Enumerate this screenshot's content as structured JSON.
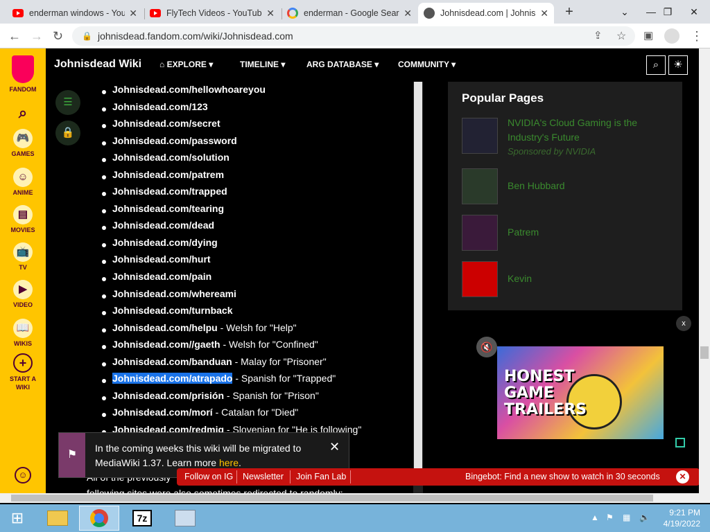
{
  "tabs": [
    {
      "title": "enderman windows - You",
      "icon": "youtube-icon"
    },
    {
      "title": "FlyTech Videos - YouTube",
      "icon": "youtube-icon"
    },
    {
      "title": "enderman - Google Sear",
      "icon": "google-icon"
    },
    {
      "title": "Johnisdead.com | Johnis",
      "icon": "fandom-favicon-icon",
      "active": true
    }
  ],
  "address": {
    "url": "johnisdead.fandom.com/wiki/Johnisdead.com"
  },
  "fandom_sidebar": {
    "brand": "FANDOM",
    "items": [
      "GAMES",
      "ANIME",
      "MOVIES",
      "TV",
      "VIDEO",
      "WIKIS",
      "START A WIKI"
    ]
  },
  "wiki_header": {
    "title": "Johnisdead Wiki",
    "nav": [
      "EXPLORE",
      "TIMELINE",
      "ARG DATABASE",
      "COMMUNITY"
    ]
  },
  "links": [
    {
      "link": "Johnisdead.com/hellowhoareyou",
      "note": ""
    },
    {
      "link": "Johnisdead.com/123",
      "note": ""
    },
    {
      "link": "Johnisdead.com/secret",
      "note": ""
    },
    {
      "link": "Johnisdead.com/password",
      "note": ""
    },
    {
      "link": "Johnisdead.com/solution",
      "note": ""
    },
    {
      "link": "Johnisdead.com/patrem",
      "note": ""
    },
    {
      "link": "Johnisdead.com/trapped",
      "note": ""
    },
    {
      "link": "Johnisdead.com/tearing",
      "note": ""
    },
    {
      "link": "Johnisdead.com/dead",
      "note": ""
    },
    {
      "link": "Johnisdead.com/dying",
      "note": ""
    },
    {
      "link": "Johnisdead.com/hurt",
      "note": ""
    },
    {
      "link": "Johnisdead.com/pain",
      "note": ""
    },
    {
      "link": "Johnisdead.com/whereami",
      "note": ""
    },
    {
      "link": "Johnisdead.com/turnback",
      "note": ""
    },
    {
      "link": "Johnisdead.com/helpu",
      "note": " - Welsh for \"Help\""
    },
    {
      "link": "Johnisdead.com//gaeth",
      "note": " - Welsh for \"Confined\""
    },
    {
      "link": "Johnisdead.com/banduan",
      "note": " - Malay for \"Prisoner\""
    },
    {
      "link": "Johnisdead.com/atrapado",
      "note": " - Spanish for \"Trapped\"",
      "selected": true
    },
    {
      "link": "Johnisdead.com/prisión",
      "note": " - Spanish for \"Prison\""
    },
    {
      "link": "Johnisdead.com/morí",
      "note": " - Catalan for \"Died\""
    },
    {
      "link": "Johnisdead.com/redmig",
      "note": " - Slovenian for \"He is following\""
    }
  ],
  "below_text": [
    "All of the previously",
    "following sites were also sometimes redirected to randomly:"
  ],
  "popular": {
    "title": "Popular Pages",
    "items": [
      {
        "title": "NVIDIA's Cloud Gaming is the Industry's Future",
        "sponsor": "Sponsored by NVIDIA"
      },
      {
        "title": "Ben Hubbard"
      },
      {
        "title": "Patrem"
      },
      {
        "title": "Kevin"
      }
    ]
  },
  "video": {
    "thumb_text": "HONEST GAME TRAILERS"
  },
  "notice": {
    "text": "In the coming weeks this wiki will be migrated to MediaWiki 1.37. Learn more ",
    "link": "here",
    "end": "."
  },
  "global_bar": {
    "links": [
      "Follow on IG",
      "Newsletter",
      "Join Fan Lab"
    ],
    "promo": "Bingebot: Find a new show to watch in 30 seconds"
  },
  "taskbar": {
    "time": "9:21 PM",
    "date": "4/19/2022"
  }
}
